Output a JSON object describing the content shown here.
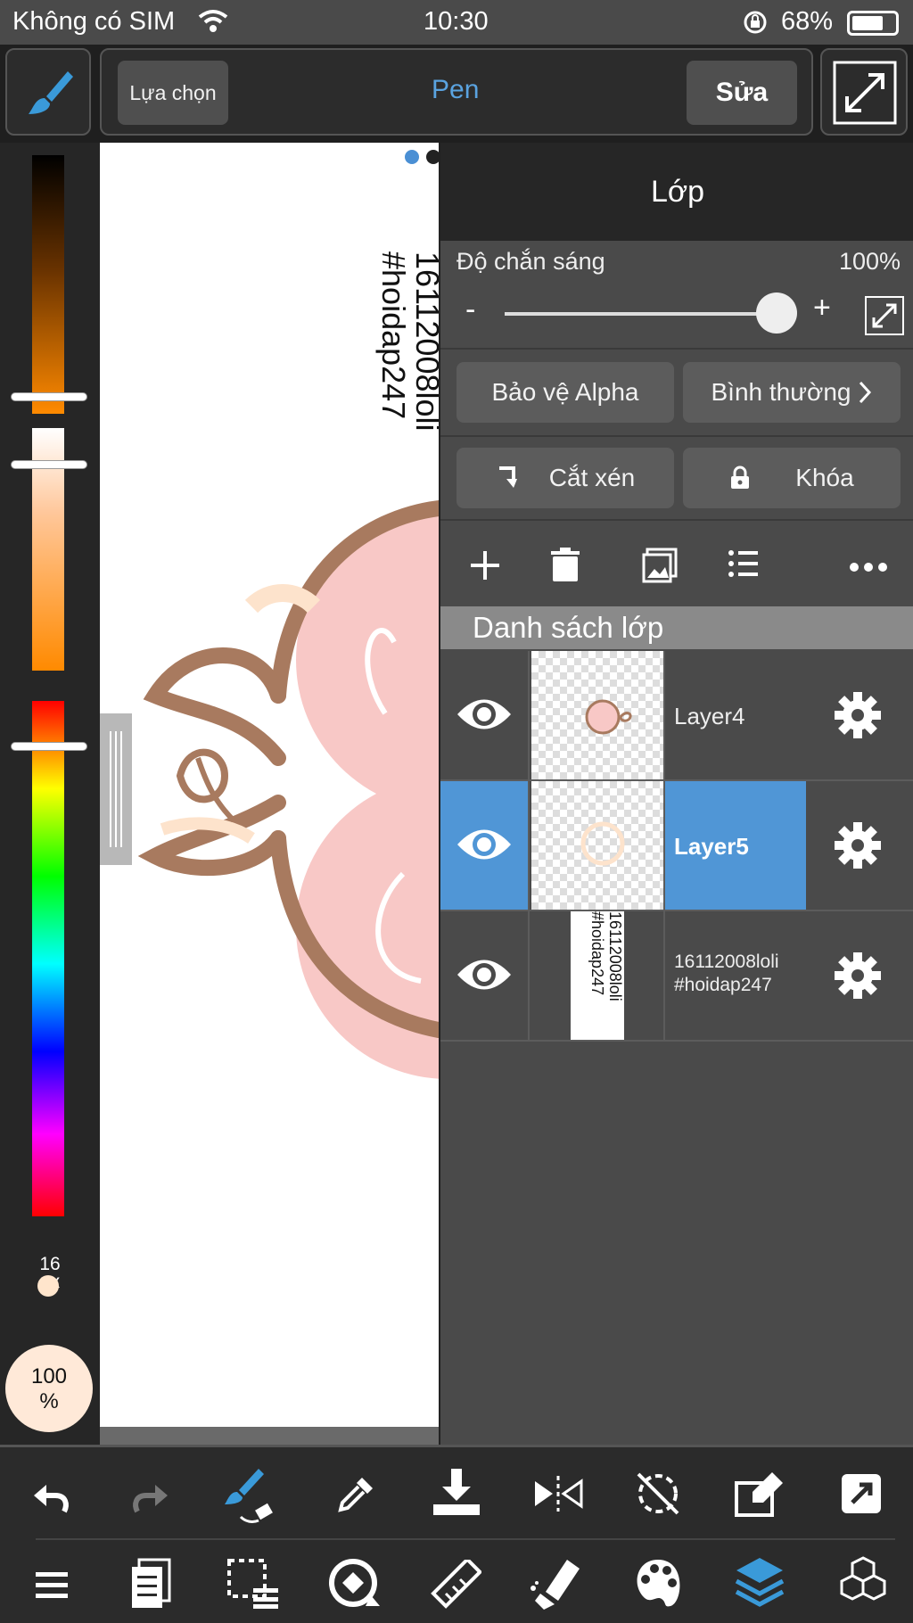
{
  "status_bar": {
    "carrier": "Không có SIM",
    "time": "10:30",
    "battery": "68%",
    "icons": [
      "wifi-icon",
      "rotation-lock-icon",
      "battery-icon"
    ]
  },
  "top_toolbar": {
    "select_label": "Lựa chọn",
    "tool_title": "Pen",
    "edit_label": "Sửa",
    "icons": [
      "brush-icon",
      "fullscreen-icon"
    ]
  },
  "color_panel": {
    "brush_size": "16\npx",
    "opacity": "100\n%"
  },
  "canvas": {
    "watermark": "16112008loli\n#hoidap247"
  },
  "layer_panel": {
    "title": "Lớp",
    "opacity_label": "Độ chắn sáng",
    "opacity_value": "100%",
    "opacity_minus": "-",
    "opacity_plus": "+",
    "alpha_protect_label": "Bảo vệ Alpha",
    "blend_mode_label": "Bình thường",
    "clipping_label": "Cắt xén",
    "lock_label": "Khóa",
    "list_header": "Danh sách lớp",
    "layers": [
      {
        "name": "Layer4",
        "selected": false
      },
      {
        "name": "Layer5",
        "selected": true
      },
      {
        "name": "16112008loli\n#hoidap247",
        "selected": false
      }
    ],
    "layer3_thumb_text": "16112008loli\n#hoidap247"
  },
  "colors": {
    "accent_blue": "#5096d6",
    "title_blue": "#5aa3e0",
    "panel_bg": "#4a4a4a",
    "toolbar_bg": "#1f1f1f"
  }
}
